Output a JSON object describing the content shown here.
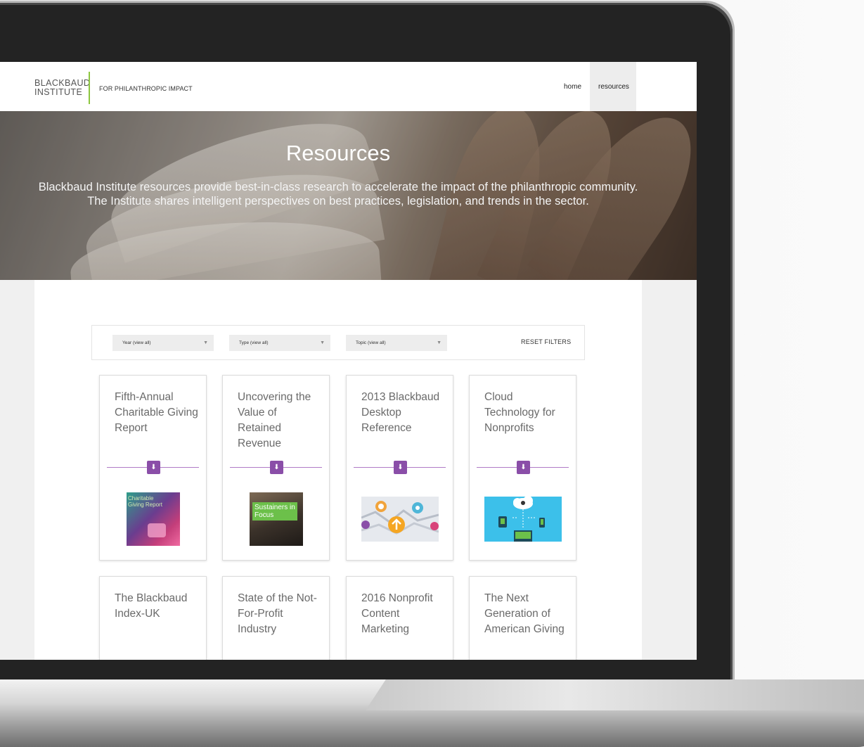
{
  "header": {
    "logo_line1": "BLACKBAUD",
    "logo_line2": "INSTITUTE",
    "tagline": "FOR PHILANTHROPIC IMPACT",
    "nav": [
      {
        "label": "home",
        "active": false
      },
      {
        "label": "resources",
        "active": true
      }
    ]
  },
  "hero": {
    "title": "Resources",
    "description": "Blackbaud Institute resources provide best-in-class research to accelerate the impact of the philanthropic community. The Institute shares intelligent perspectives on best practices, legislation, and trends in the sector."
  },
  "filters": {
    "year": "Year (view all)",
    "type": "Type (view all)",
    "topic": "Topic (view all)",
    "reset": "RESET FILTERS",
    "caret": "▼"
  },
  "download_icon": "⬇",
  "cards": [
    {
      "title": "Fifth-Annual Charitable Giving Report",
      "thumb": "charitable-giving-report-cover",
      "thumb_label": "Charitable Giving Report"
    },
    {
      "title": "Uncovering the Value of Retained Revenue",
      "thumb": "sustainers-in-focus-cover",
      "thumb_label": "Sustainers in Focus"
    },
    {
      "title": "2013 Blackbaud Desktop Reference",
      "thumb": "map-pins-illustration"
    },
    {
      "title": "Cloud Technology for Nonprofits",
      "thumb": "cloud-devices-illustration"
    },
    {
      "title": "The Blackbaud Index-UK"
    },
    {
      "title": "State of the Not-For-Profit Industry"
    },
    {
      "title": "2016 Nonprofit Content Marketing"
    },
    {
      "title": "The Next Generation of American Giving"
    }
  ],
  "colors": {
    "accent_green": "#8dc63f",
    "accent_purple": "#8a4ea8",
    "line_purple": "#b07bc6"
  }
}
